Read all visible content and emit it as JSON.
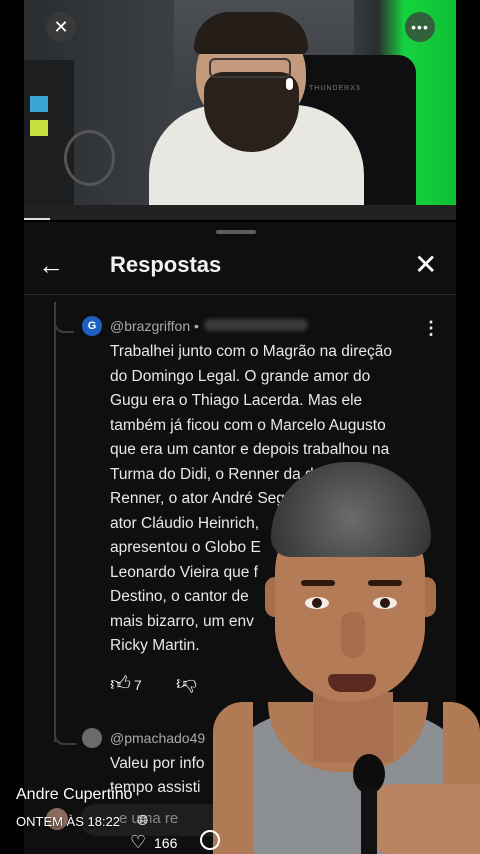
{
  "panel": {
    "title": "Respostas",
    "back_icon": "arrow-left-icon",
    "close_icon": "close-icon"
  },
  "comment": {
    "avatar_letter": "G",
    "handle": "@brazgriffon •",
    "text": "Trabalhei junto com o Magrão na direção\ndo Domingo Legal. O grande amor do\nGugu era o Thiago Lacerda.  Mas ele\ntambém já ficou com o Marcelo Augusto\nque era um cantor e depois trabalhou na\nTurma do Didi, o Renner da d\nRenner, o ator André Seg\nator Cláudio Heinrich,\napresentou o Globo E\nLeonardo Vieira que f\nDestino, o cantor de\nmais bizarro, um env\nRicky Martin.",
    "likes": "7"
  },
  "reply": {
    "handle": "@pmachado49",
    "text": "Valeu por info\ntempo assisti",
    "placeholder": "e uma re"
  },
  "footer": {
    "author": "Andre Cupertino",
    "date": "ONTEM ÀS 18:22",
    "hearts": "166"
  },
  "video": {
    "chair_label": "THUNDERX3"
  }
}
